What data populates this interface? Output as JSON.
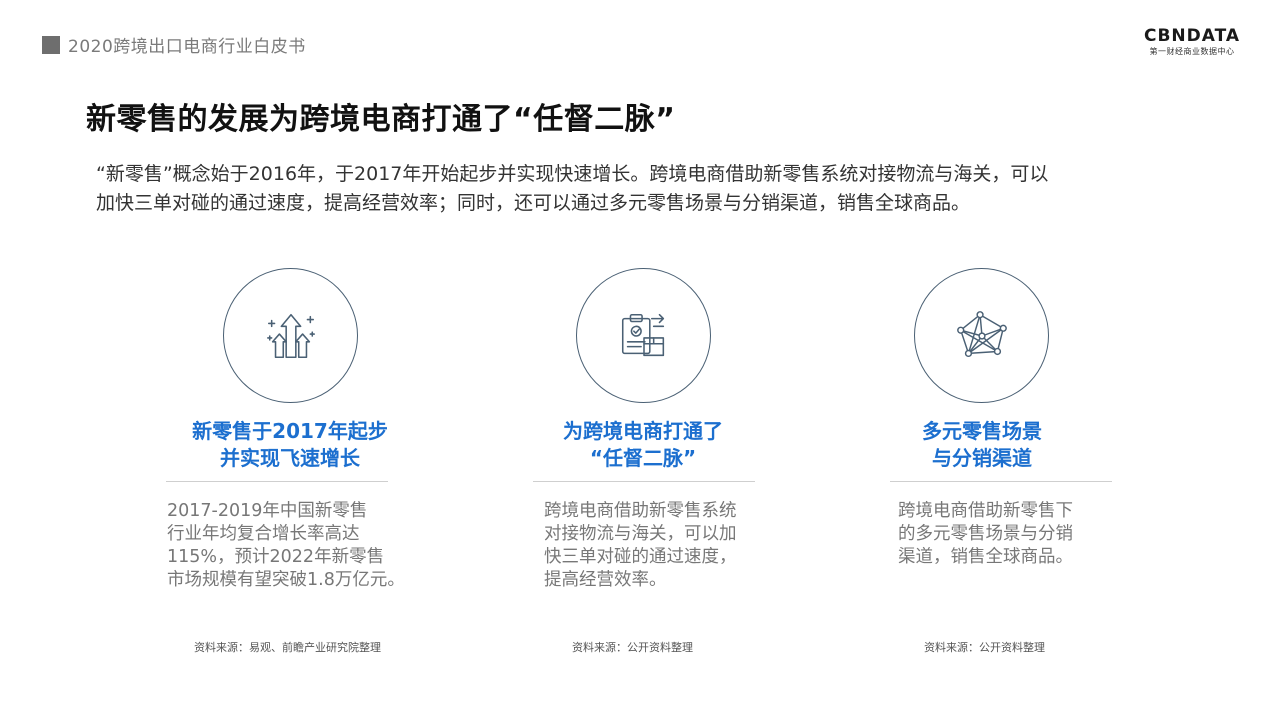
{
  "header": {
    "title": "2020跨境出口电商行业白皮书"
  },
  "logo": {
    "main": "CBNDATA",
    "sub": "第一财经商业数据中心"
  },
  "main_title": "新零售的发展为跨境电商打通了“任督二脉”",
  "intro": {
    "line1": "“新零售”概念始于2016年，于2017年开始起步并实现快速增长。跨境电商借助新零售系统对接物流与海关，可以",
    "line2": "加快三单对碰的通过速度，提高经营效率；同时，还可以通过多元零售场景与分销渠道，销售全球商品。"
  },
  "columns": [
    {
      "icon": "growth-arrows-icon",
      "heading_line1": "新零售于2017年起步",
      "heading_line2": "并实现飞速增长",
      "body": [
        "2017-2019年中国新零售",
        "行业年均复合增长率高达",
        "115%，预计2022年新零售",
        "市场规模有望突破1.8万亿元。"
      ],
      "source": "资料来源：易观、前瞻产业研究院整理"
    },
    {
      "icon": "clipboard-box-icon",
      "heading_line1": "为跨境电商打通了",
      "heading_line2": "“任督二脉”",
      "body": [
        "跨境电商借助新零售系统",
        "对接物流与海关，可以加",
        "快三单对碰的通过速度，",
        "提高经营效率。"
      ],
      "source": "资料来源：公开资料整理"
    },
    {
      "icon": "network-icon",
      "heading_line1": "多元零售场景",
      "heading_line2": "与分销渠道",
      "body": [
        "跨境电商借助新零售下",
        "的多元零售场景与分销",
        "渠道，销售全球商品。"
      ],
      "source": "资料来源：公开资料整理"
    }
  ],
  "colors": {
    "accent": "#1c6fcf",
    "icon_stroke": "#4a6074"
  }
}
